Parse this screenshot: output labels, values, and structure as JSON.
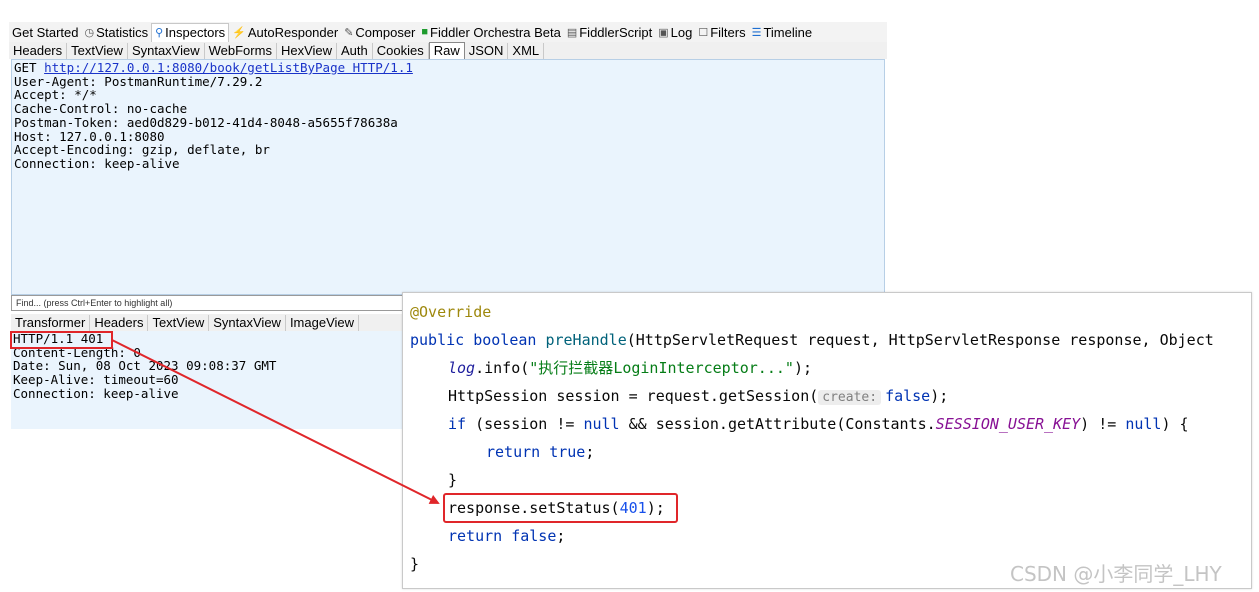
{
  "fiddler": {
    "tabs": [
      {
        "icon": "rocket-icon",
        "label": "Get Started"
      },
      {
        "icon": "timer-icon",
        "label": "Statistics"
      },
      {
        "icon": "inspect-icon",
        "label": "Inspectors"
      },
      {
        "icon": "lightning-icon",
        "label": "AutoResponder"
      },
      {
        "icon": "compose-icon",
        "label": "Composer"
      },
      {
        "icon": "fo-icon",
        "label": "Fiddler Orchestra Beta"
      },
      {
        "icon": "script-icon",
        "label": "FiddlerScript"
      },
      {
        "icon": "log-icon",
        "label": "Log"
      },
      {
        "icon": "filter-checkbox-icon",
        "label": "Filters"
      },
      {
        "icon": "timeline-icon",
        "label": "Timeline"
      }
    ],
    "request_tabs": [
      "Headers",
      "TextView",
      "SyntaxView",
      "WebForms",
      "HexView",
      "Auth",
      "Cookies",
      "Raw",
      "JSON",
      "XML"
    ],
    "request": {
      "method": "GET ",
      "url": "http://127.0.0.1:8080/book/getListByPage HTTP/1.1",
      "headers": [
        "User-Agent: PostmanRuntime/7.29.2",
        "Accept: */*",
        "Cache-Control: no-cache",
        "Postman-Token: aed0d829-b012-41d4-8048-a5655f78638a",
        "Host: 127.0.0.1:8080",
        "Accept-Encoding: gzip, deflate, br",
        "Connection: keep-alive"
      ]
    },
    "find_placeholder": "Find... (press Ctrl+Enter to highlight all)",
    "response_tabs": [
      "Transformer",
      "Headers",
      "TextView",
      "SyntaxView",
      "ImageView"
    ],
    "response": {
      "status": "HTTP/1.1 401",
      "headers": [
        "Content-Length: 0",
        "Date: Sun, 08 Oct 2023 09:08:37 GMT",
        "Keep-Alive: timeout=60",
        "Connection: keep-alive"
      ]
    }
  },
  "code": {
    "annotation": "@Override",
    "line2_kw": "public boolean ",
    "line2_fn": "preHandle",
    "line2_rest": "(HttpServletRequest request, HttpServletResponse response, Object",
    "log_var": "log",
    "log_call": ".info(",
    "log_str": "\"执行拦截器LoginInterceptor...\"",
    "log_end": ");",
    "session_pre": "HttpSession session = request.getSession(",
    "session_hint": "create:",
    "session_false": "false",
    "session_end": ");",
    "if_kw": "if",
    "if_mid1": " (session != ",
    "if_null1": "null",
    "if_mid2": " && session.getAttribute(Constants.",
    "if_const": "SESSION_USER_KEY",
    "if_mid3": ") != ",
    "if_null2": "null",
    "if_end": ") {",
    "return_kw": "return ",
    "return_true": "true",
    "semicolon": ";",
    "close_brace": "}",
    "set_status_pre": "response.setStatus(",
    "set_status_num": "401",
    "set_status_end": ");",
    "return_false": "false",
    "final_brace": "}"
  },
  "watermark": "CSDN @小李同学_LHY",
  "colors": {
    "highlight_box": "#e0262a",
    "arrow": "#e0262a",
    "request_bg": "#eaf4fd"
  }
}
